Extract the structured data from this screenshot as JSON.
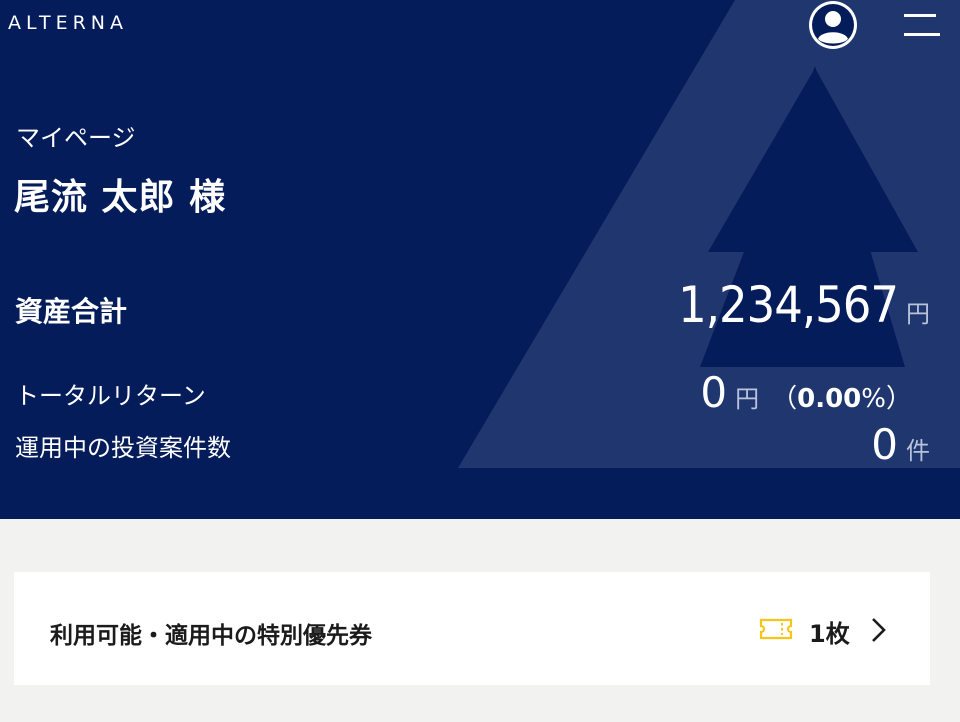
{
  "header": {
    "logo_text": "ALTERNA",
    "icons": {
      "user": "user-circle-icon",
      "menu": "menu-icon"
    }
  },
  "profile": {
    "page_label": "マイページ",
    "user_name": "尾流 太郎 様"
  },
  "summary": {
    "total_assets": {
      "label": "資産合計",
      "value": "1,234,567",
      "unit": "円"
    },
    "total_return": {
      "label": "トータルリターン",
      "value": "0",
      "unit": "円",
      "pct_open": "（",
      "pct_value": "0.00",
      "pct_symbol": "%",
      "pct_close": "）"
    },
    "active_investments": {
      "label": "運用中の投資案件数",
      "value": "0",
      "unit": "件"
    }
  },
  "coupon_card": {
    "title": "利用可能・適用中の特別優先券",
    "count": "1枚",
    "icon": "ticket-icon",
    "accent_color": "#f5c518"
  },
  "colors": {
    "hero_bg": "#041c5a",
    "page_bg": "#f2f2f0"
  }
}
